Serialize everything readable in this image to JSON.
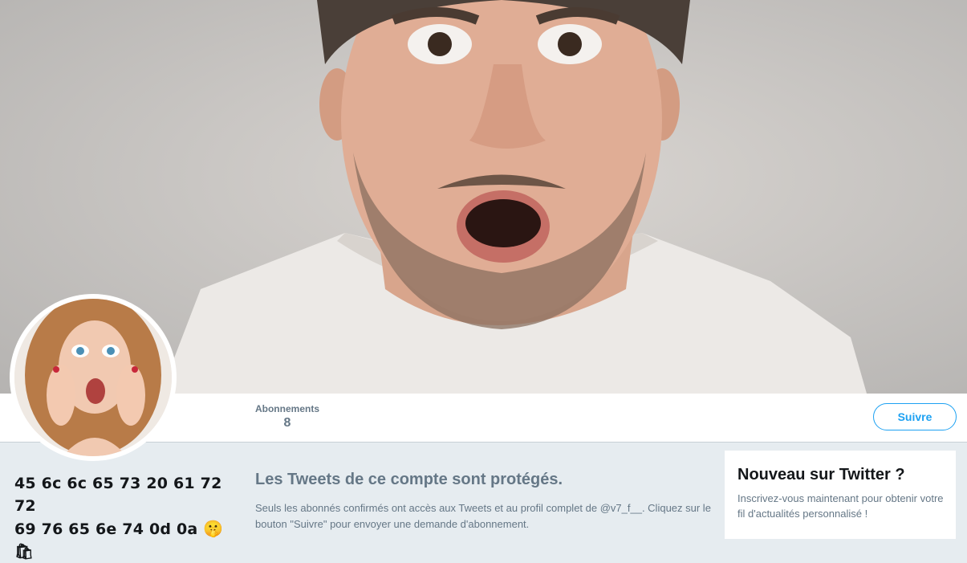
{
  "banner": {
    "description_icon": "header-photo"
  },
  "avatar": {
    "icon": "profile-avatar"
  },
  "stats": {
    "following_label": "Abonnements",
    "following_value": "8"
  },
  "follow_button": {
    "label": "Suivre"
  },
  "bio": {
    "line1": "45 6c 6c 65 73 20 61 72 72",
    "line2": "69 76 65 6e 74 0d 0a",
    "emoji": "🤫",
    "line3": "🛍"
  },
  "protected": {
    "title": "Les Tweets de ce compte sont protégés.",
    "text": "Seuls les abonnés confirmés ont accès aux Tweets et au profil complet de @v7_f__. Cliquez sur le bouton \"Suivre\" pour envoyer une demande d'abonnement."
  },
  "signup": {
    "title": "Nouveau sur Twitter ?",
    "text": "Inscrivez-vous maintenant pour obtenir votre fil d'actualités personnalisé !"
  },
  "colors": {
    "accent": "#1da1f2",
    "muted": "#657786",
    "background": "#e6ecf0"
  }
}
